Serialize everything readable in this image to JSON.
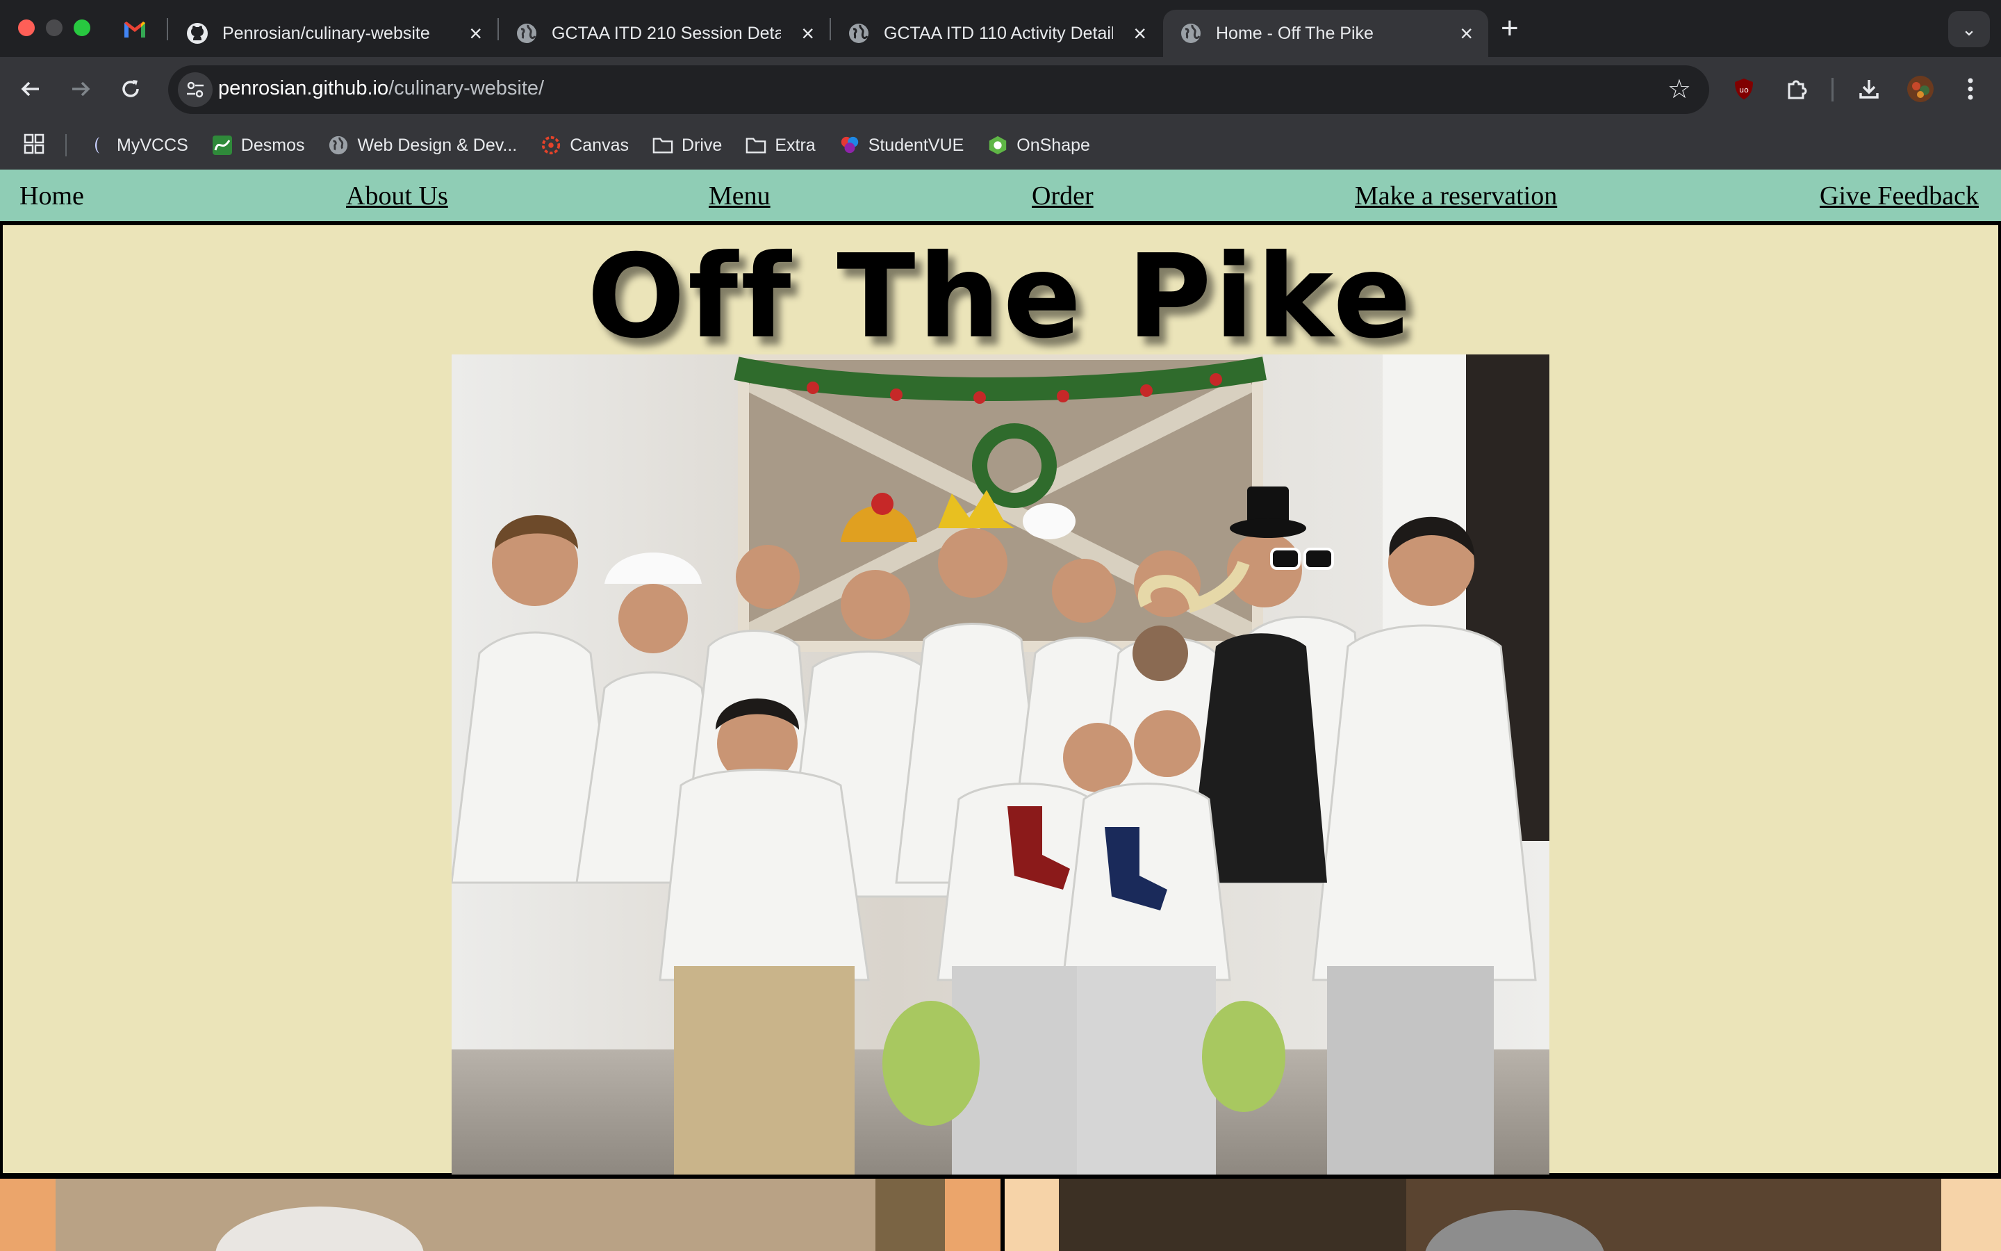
{
  "browser": {
    "tabs": [
      {
        "title": "Penrosian/culinary-website",
        "favicon": "github-icon"
      },
      {
        "title": "GCTAA ITD 210 Session Detai",
        "favicon": "globe-icon"
      },
      {
        "title": "GCTAA ITD 110 Activity Detail",
        "favicon": "globe-icon"
      },
      {
        "title": "Home - Off The Pike",
        "favicon": "globe-icon",
        "active": true
      }
    ],
    "new_tab_label": "+",
    "url_host": "penrosian.github.io",
    "url_path": "/culinary-website/",
    "bookmarks": [
      {
        "label": "MyVCCS",
        "icon": "myvccs-icon"
      },
      {
        "label": "Desmos",
        "icon": "desmos-icon"
      },
      {
        "label": "Web Design & Dev...",
        "icon": "globe-icon"
      },
      {
        "label": "Canvas",
        "icon": "canvas-icon"
      },
      {
        "label": "Drive",
        "icon": "folder-icon"
      },
      {
        "label": "Extra",
        "icon": "folder-icon"
      },
      {
        "label": "StudentVUE",
        "icon": "studentvue-icon"
      },
      {
        "label": "OnShape",
        "icon": "onshape-icon"
      }
    ]
  },
  "site": {
    "nav": {
      "home": "Home",
      "about": "About Us",
      "menu": "Menu",
      "order": "Order",
      "reservation": "Make a reservation",
      "feedback": "Give Feedback"
    },
    "title": "Off The Pike",
    "colors": {
      "nav_bg": "#8fcdb5",
      "page_bg": "#ebe4b9",
      "border": "#000000"
    }
  }
}
